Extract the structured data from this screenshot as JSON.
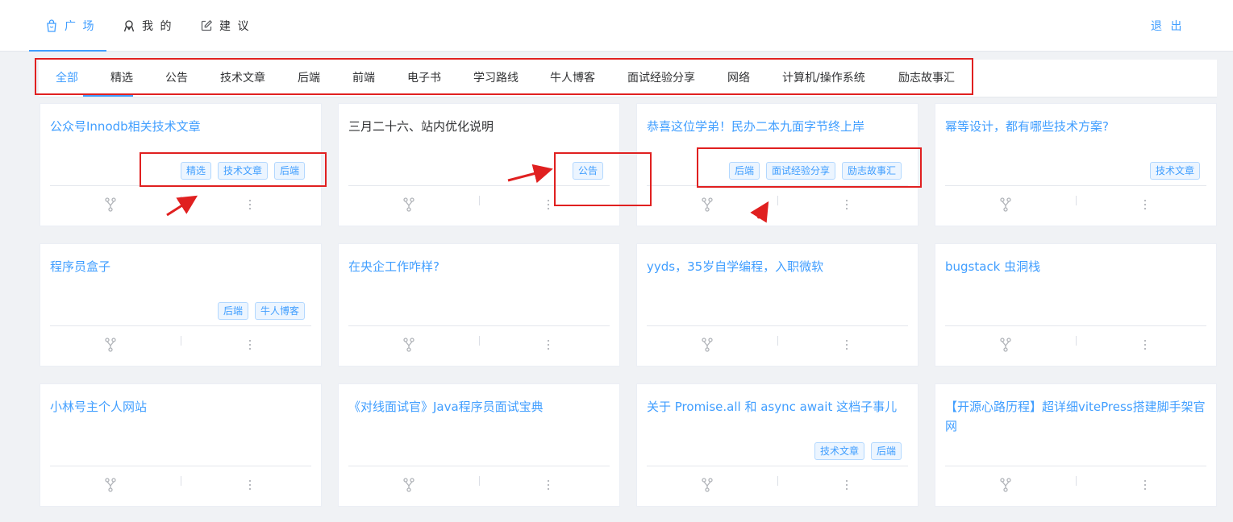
{
  "topnav": {
    "tabs": [
      {
        "label": "广 场",
        "active": true,
        "icon": "shopping-bag-icon"
      },
      {
        "label": "我 的",
        "active": false,
        "icon": "user-icon"
      },
      {
        "label": "建 议",
        "active": false,
        "icon": "edit-icon"
      }
    ],
    "logout_label": "退 出"
  },
  "categories": [
    "全部",
    "精选",
    "公告",
    "技术文章",
    "后端",
    "前端",
    "电子书",
    "学习路线",
    "牛人博客",
    "面试经验分享",
    "网络",
    "计算机/操作系统",
    "励志故事汇"
  ],
  "active_category": "全部",
  "cards": [
    {
      "title": "公众号Innodb相关技术文章",
      "tags": [
        "精选",
        "技术文章",
        "后端"
      ]
    },
    {
      "title": "三月二十六、站内优化说明",
      "tags": [
        "公告"
      ]
    },
    {
      "title": "恭喜这位学弟！民办二本九面字节终上岸",
      "tags": [
        "后端",
        "面试经验分享",
        "励志故事汇"
      ]
    },
    {
      "title": "幂等设计，都有哪些技术方案?",
      "tags": [
        "技术文章"
      ]
    },
    {
      "title": "程序员盒子",
      "tags": [
        "后端",
        "牛人博客"
      ]
    },
    {
      "title": "在央企工作咋样?",
      "tags": []
    },
    {
      "title": "yyds，35岁自学编程，入职微软",
      "tags": []
    },
    {
      "title": "bugstack 虫洞栈",
      "tags": []
    },
    {
      "title": "小林号主个人网站",
      "tags": []
    },
    {
      "title": "《对线面试官》Java程序员面试宝典",
      "tags": []
    },
    {
      "title": "关于 Promise.all 和 async await 这档子事儿",
      "tags": [
        "技术文章",
        "后端"
      ]
    },
    {
      "title": "【开源心路历程】超详细vitePress搭建脚手架官网",
      "tags": []
    }
  ],
  "card_icons": {
    "fork": "fork-icon",
    "more": "more-vertical-icon"
  },
  "colors": {
    "accent": "#409eff",
    "annotation": "#e02020",
    "background": "#f0f2f5"
  }
}
